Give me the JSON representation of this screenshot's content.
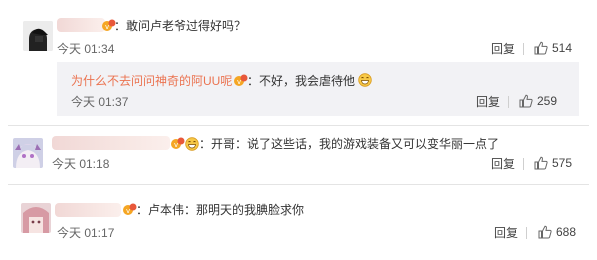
{
  "comments": [
    {
      "text": "：敢问卢老爷过得好吗？",
      "time": "今天 01:34",
      "reply_label": "回复",
      "likes": "514",
      "reply": {
        "author": "为什么不去问问神奇的阿UU呢",
        "text": "：不好，我会虐待他",
        "time": "今天 01:37",
        "reply_label": "回复",
        "likes": "259"
      }
    },
    {
      "text": "：开哥：说了这些话，我的游戏装备又可以变华丽一点了",
      "time": "今天 01:18",
      "reply_label": "回复",
      "likes": "575"
    },
    {
      "text": "：卢本伟：那明天的我腆脸求你",
      "time": "今天 01:17",
      "reply_label": "回复",
      "likes": "688"
    }
  ],
  "colors": {
    "link": "#eb7350",
    "reply_bg": "#f2f2f5",
    "name_blur": "#f3dcd9"
  },
  "icons": [
    "avatar",
    "vip-badge-icon",
    "thumbs-up-icon",
    "grin-emoji-icon"
  ]
}
